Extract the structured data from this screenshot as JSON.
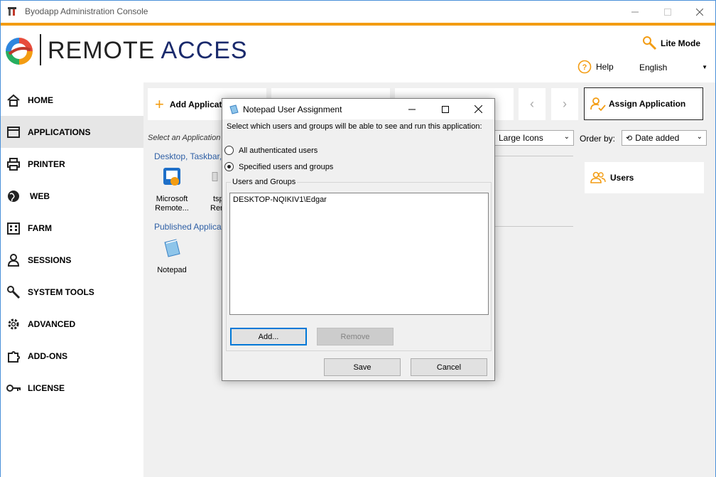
{
  "window": {
    "title": "Byodapp Administration Console"
  },
  "header": {
    "logo_word1": "REMOTE",
    "logo_word2": "ACCES",
    "lite_mode": "Lite Mode",
    "help": "Help",
    "language": "English"
  },
  "sidebar": {
    "items": [
      {
        "label": "HOME",
        "icon": "home-icon"
      },
      {
        "label": "APPLICATIONS",
        "icon": "window-icon"
      },
      {
        "label": "PRINTER",
        "icon": "printer-icon"
      },
      {
        "label": "WEB",
        "icon": "globe-icon"
      },
      {
        "label": "FARM",
        "icon": "building-icon"
      },
      {
        "label": "SESSIONS",
        "icon": "user-icon"
      },
      {
        "label": "SYSTEM TOOLS",
        "icon": "wrench-icon"
      },
      {
        "label": "ADVANCED",
        "icon": "gear-icon"
      },
      {
        "label": "ADD-ONS",
        "icon": "puzzle-icon"
      },
      {
        "label": "LICENSE",
        "icon": "key-icon"
      }
    ]
  },
  "main": {
    "add_application": "Add Applicati",
    "assign_application": "Assign Application",
    "select_prompt": "Select an Application t",
    "view_mode": "Large Icons",
    "order_by_label": "Order by:",
    "order_by_value": "Date added",
    "section_desktop": "Desktop, Taskbar, ",
    "section_published": "Published Applica",
    "desktop_apps": [
      {
        "line1": "Microsoft",
        "line2": "Remote..."
      },
      {
        "line1": "tsp",
        "line2": "Rer"
      }
    ],
    "published_apps": [
      {
        "line1": "Notepad"
      }
    ],
    "users_button": "Users"
  },
  "dialog": {
    "title": "Notepad User Assignment",
    "description": "Select which users and groups will be able to see and run this application:",
    "radio_all": "All authenticated users",
    "radio_specified": "Specified users and groups",
    "selected_option": "Specified users and groups",
    "group_label": "Users and Groups",
    "users": [
      "DESKTOP-NQIKIV1\\Edgar"
    ],
    "add_button": "Add...",
    "remove_button": "Remove",
    "save_button": "Save",
    "cancel_button": "Cancel"
  },
  "colors": {
    "accent": "#f39c12",
    "link": "#2e5fa5",
    "logo_blue": "#1a2a6c"
  }
}
